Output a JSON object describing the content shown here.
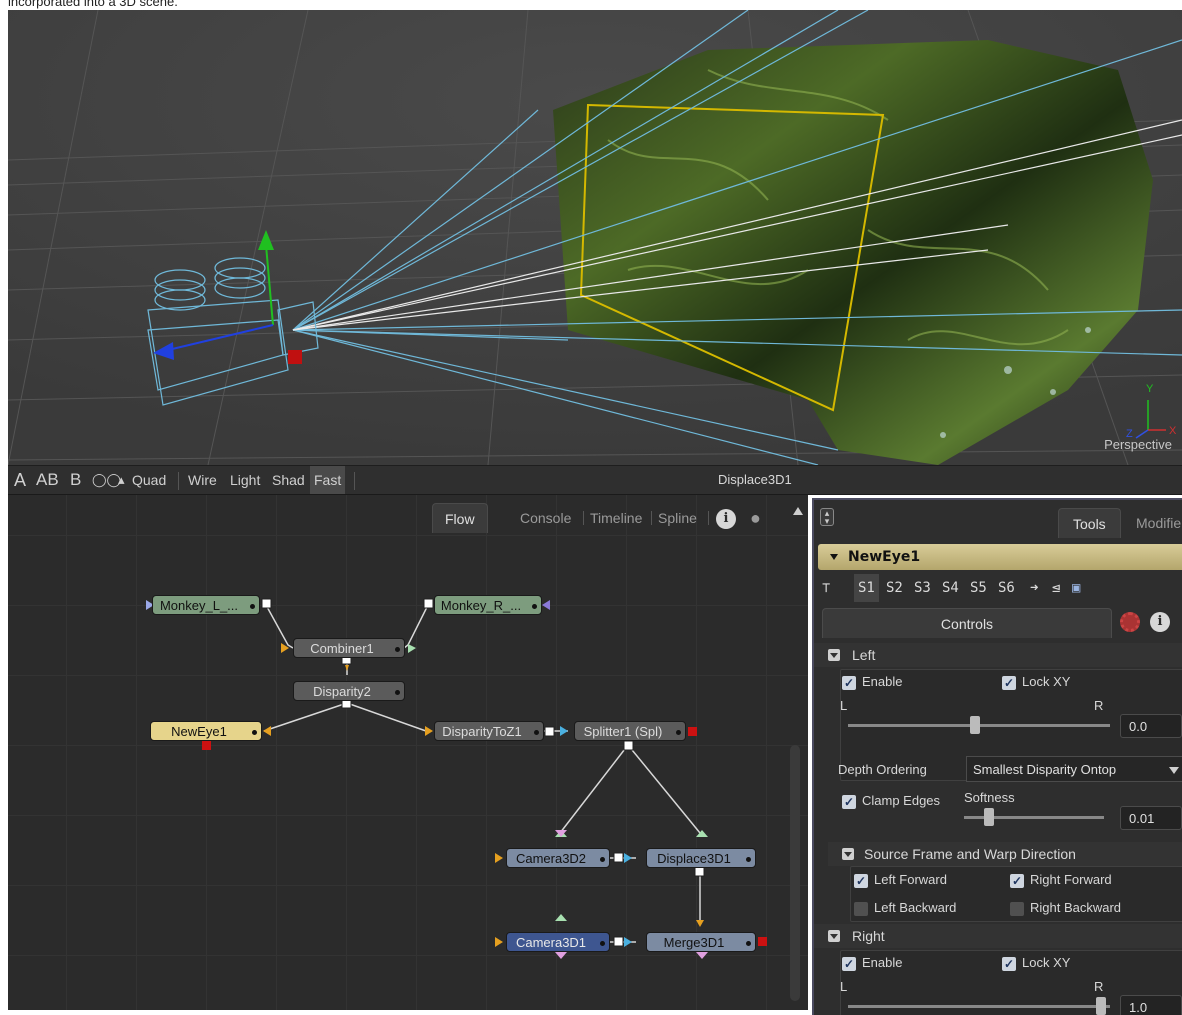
{
  "caption": "incorporated into a 3D scene.",
  "viewport": {
    "view_label": "Perspective",
    "axis_labels": {
      "x": "X",
      "y": "Y",
      "z": "Z"
    }
  },
  "viewer_toolbar": {
    "a_label": "A",
    "ab_label": "AB",
    "b_label": "B",
    "quad_label": "Quad",
    "wire_label": "Wire",
    "light_label": "Light",
    "shad_label": "Shad",
    "fast_label": "Fast",
    "title": "Displace3D1"
  },
  "flow": {
    "tabs": {
      "flow": "Flow",
      "console": "Console",
      "timeline": "Timeline",
      "spline": "Spline"
    },
    "info_label": "i",
    "nodes": {
      "monkey_l": "Monkey_L_...",
      "monkey_r": "Monkey_R_...",
      "combiner": "Combiner1",
      "disparity": "Disparity2",
      "neweye": "NewEye1",
      "disparitytoz": "DisparityToZ1",
      "splitter": "Splitter1 (Spl)",
      "camera3d2": "Camera3D2",
      "displace3d": "Displace3D1",
      "camera3d1": "Camera3D1",
      "merge3d": "Merge3D1"
    },
    "colors": {
      "link": "#d8d8d8",
      "input_arrow": "#e6a020",
      "pink": "#e0a0e0",
      "mint": "#a8e0b0",
      "output_red": "#cc1111"
    }
  },
  "tools": {
    "tabs": {
      "tools": "Tools",
      "modifiers": "Modifie"
    },
    "tool_name": "NewEye1",
    "slots": [
      "S1",
      "S2",
      "S3",
      "S4",
      "S5",
      "S6"
    ],
    "controls_label": "Controls",
    "info_label": "i",
    "left": {
      "title": "Left",
      "enable": "Enable",
      "lock_xy": "Lock XY",
      "l": "L",
      "r": "R",
      "value": "0.0"
    },
    "depth_ordering": {
      "label": "Depth Ordering",
      "value": "Smallest Disparity Ontop"
    },
    "clamp_edges": "Clamp Edges",
    "softness": {
      "label": "Softness",
      "value": "0.01"
    },
    "source_frame": {
      "title": "Source Frame and Warp Direction",
      "left_forward": "Left Forward",
      "right_forward": "Right Forward",
      "left_backward": "Left Backward",
      "right_backward": "Right Backward"
    },
    "right": {
      "title": "Right",
      "enable": "Enable",
      "lock_xy": "Lock XY",
      "l": "L",
      "r": "R",
      "value": "1.0"
    }
  }
}
